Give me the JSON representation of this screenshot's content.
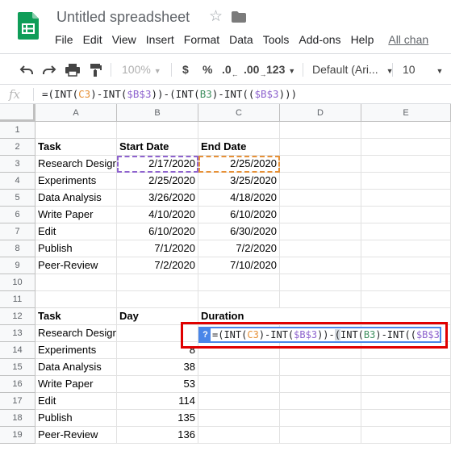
{
  "app": {
    "title": "Untitled spreadsheet",
    "star_glyph": "☆",
    "menus": [
      "File",
      "Edit",
      "View",
      "Insert",
      "Format",
      "Data",
      "Tools",
      "Add-ons",
      "Help"
    ],
    "all_changes_link": "All chan"
  },
  "toolbar": {
    "zoom": "100%",
    "currency": "$",
    "percent": "%",
    "decrease_decimal": ".0",
    "increase_decimal": ".00",
    "more_formats": "123",
    "font": "Default (Ari...",
    "font_size": "10"
  },
  "formula_bar": {
    "fx_label": "fx",
    "parts": [
      "=(INT(",
      "C3",
      ")-INT(",
      "$B$3",
      "))-",
      "(",
      "INT(",
      "B3",
      ")-INT(",
      "(",
      "$B$3",
      "))",
      ")"
    ]
  },
  "editor": {
    "help_glyph": "?",
    "parts": [
      "=(INT(",
      "C3",
      ")-INT(",
      "$B$3",
      "))-",
      "(",
      "INT(",
      "B3",
      ")-INT((",
      "$B$3",
      "))",
      ")"
    ]
  },
  "grid": {
    "columns": [
      "A",
      "B",
      "C",
      "D",
      "E"
    ],
    "rows": [
      "1",
      "2",
      "3",
      "4",
      "5",
      "6",
      "7",
      "8",
      "9",
      "10",
      "11",
      "12",
      "13",
      "14",
      "15",
      "16",
      "17",
      "18",
      "19"
    ],
    "table1": {
      "headers": [
        "Task",
        "Start Date",
        "End Date"
      ],
      "rows": [
        [
          "Research Design",
          "2/17/2020",
          "2/25/2020"
        ],
        [
          "Experiments",
          "2/25/2020",
          "3/25/2020"
        ],
        [
          "Data Analysis",
          "3/26/2020",
          "4/18/2020"
        ],
        [
          "Write Paper",
          "4/10/2020",
          "6/10/2020"
        ],
        [
          "Edit",
          "6/10/2020",
          "6/30/2020"
        ],
        [
          "Publish",
          "7/1/2020",
          "7/2/2020"
        ],
        [
          "Peer-Review",
          "7/2/2020",
          "7/10/2020"
        ]
      ]
    },
    "table2": {
      "headers": [
        "Task",
        "Day",
        "Duration"
      ],
      "rows": [
        [
          "Research Design",
          ""
        ],
        [
          "Experiments",
          "8"
        ],
        [
          "Data Analysis",
          "38"
        ],
        [
          "Write Paper",
          "53"
        ],
        [
          "Edit",
          "114"
        ],
        [
          "Publish",
          "135"
        ],
        [
          "Peer-Review",
          "136"
        ]
      ]
    }
  },
  "colors": {
    "ref_purple": "#8e63ce",
    "ref_orange": "#e69138",
    "ref_green": "#3f8f5f",
    "editor_blue": "#4a86e8",
    "highlight_red": "#e00000",
    "sheets_green": "#0f9d58"
  }
}
